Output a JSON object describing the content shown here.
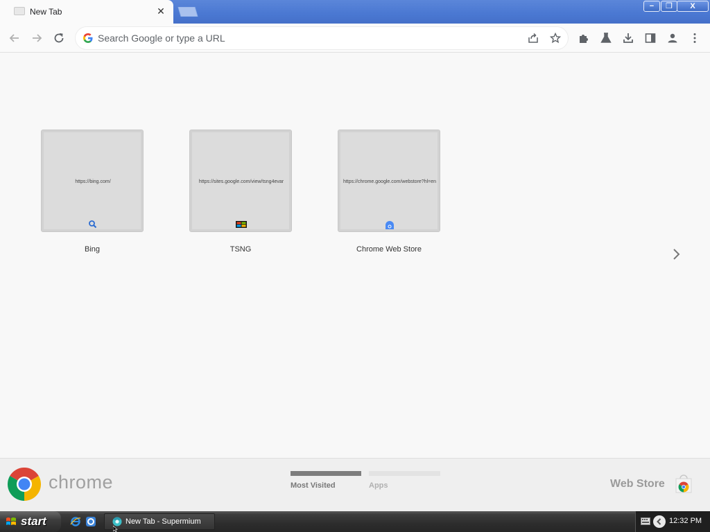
{
  "browser": {
    "tab": {
      "title": "New Tab",
      "close_glyph": "✕"
    },
    "window_controls": {
      "minimize": "−",
      "restore": "❐",
      "close": "X"
    },
    "omnibox": {
      "placeholder": "Search Google or type a URL",
      "value": ""
    },
    "toolbar_icons": [
      "back-icon",
      "forward-icon",
      "reload-icon",
      "share-icon",
      "star-icon",
      "extensions-icon",
      "labs-icon",
      "downloads-icon",
      "side-panel-icon",
      "profile-icon",
      "menu-icon"
    ]
  },
  "most_visited": [
    {
      "title": "Bing",
      "url": "https://bing.com/",
      "icon": "search-icon"
    },
    {
      "title": "TSNG",
      "url": "https://sites.google.com/view/tsng4evar",
      "icon": "tsng-icon"
    },
    {
      "title": "Chrome Web Store",
      "url": "https://chrome.google.com/webstore?hl=en",
      "icon": "web-store-icon"
    }
  ],
  "footer": {
    "logo_text": "chrome",
    "sections": [
      {
        "label": "Most Visited",
        "active": true
      },
      {
        "label": "Apps",
        "active": false
      }
    ],
    "web_store_label": "Web Store"
  },
  "taskbar": {
    "start_label": "start",
    "task_item": "New Tab - Supermium",
    "clock": "12:32 PM"
  },
  "colors": {
    "titlebar": "#4a78d2",
    "taskbar": "#2d2d2d",
    "tile": "#dcdcdc"
  }
}
